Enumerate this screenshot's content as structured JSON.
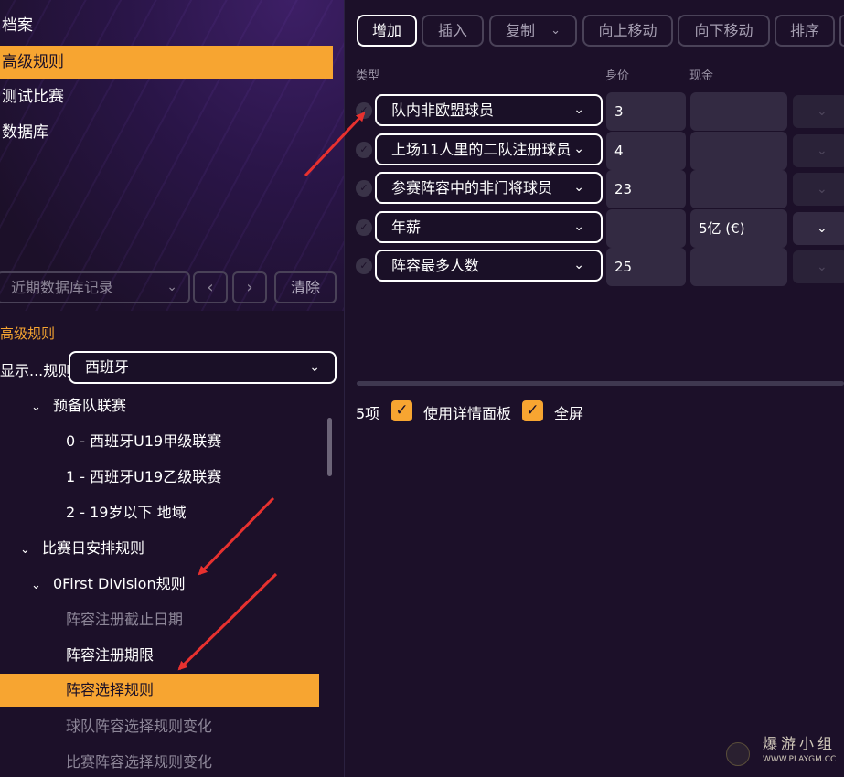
{
  "nav": {
    "items": [
      {
        "label": "档案",
        "active": false
      },
      {
        "label": "高级规则",
        "active": true
      },
      {
        "label": "测试比赛",
        "active": false
      },
      {
        "label": "数据库",
        "active": false
      }
    ]
  },
  "history": {
    "placeholder": "近期数据库记录",
    "prev_icon": "chevron-left-icon",
    "next_icon": "chevron-right-icon",
    "clear_label": "清除"
  },
  "rules": {
    "section_title": "高级规则",
    "show_label": "显示...规则",
    "league_value": "西班牙"
  },
  "tree": [
    {
      "label": "预备队联赛",
      "expanded": true,
      "style": "normal"
    },
    {
      "label": "0 - 西班牙U19甲级联赛",
      "style": "normal"
    },
    {
      "label": "1 - 西班牙U19乙级联赛",
      "style": "normal"
    },
    {
      "label": "2 - 19岁以下 地域",
      "style": "normal"
    },
    {
      "label": "比赛日安排规则",
      "expanded": true,
      "style": "normal"
    },
    {
      "label": "0First DIvision规则",
      "expanded": true,
      "style": "normal"
    },
    {
      "label": "阵容注册截止日期",
      "style": "dim"
    },
    {
      "label": "阵容注册期限",
      "style": "normal"
    },
    {
      "label": "阵容选择规则",
      "style": "selected"
    },
    {
      "label": "球队阵容选择规则变化",
      "style": "dim"
    },
    {
      "label": "比赛阵容选择规则变化",
      "style": "dim"
    }
  ],
  "toolbar": {
    "add": "增加",
    "insert": "插入",
    "copy": "复制",
    "move_up": "向上移动",
    "move_down": "向下移动",
    "sort": "排序"
  },
  "table": {
    "headers": {
      "type": "类型",
      "value": "身价",
      "cash": "现金"
    },
    "rows": [
      {
        "type": "队内非欧盟球员",
        "value": "3",
        "cash": ""
      },
      {
        "type": "上场11人里的二队注册球员",
        "value": "4",
        "cash": ""
      },
      {
        "type": "参赛阵容中的非门将球员",
        "value": "23",
        "cash": ""
      },
      {
        "type": "年薪",
        "value": "",
        "cash": "5亿 (€)"
      },
      {
        "type": "阵容最多人数",
        "value": "25",
        "cash": ""
      }
    ]
  },
  "footer": {
    "count": "5项",
    "detail_panel_label": "使用详情面板",
    "detail_panel_checked": true,
    "fullscreen_label": "全屏",
    "fullscreen_checked": true
  },
  "watermark": {
    "cn": "爆游小组",
    "url": "WWW.PLAYGM.CC"
  },
  "colors": {
    "accent": "#f7a531",
    "background": "#1c1029",
    "annotation_arrow": "#e8312f"
  }
}
